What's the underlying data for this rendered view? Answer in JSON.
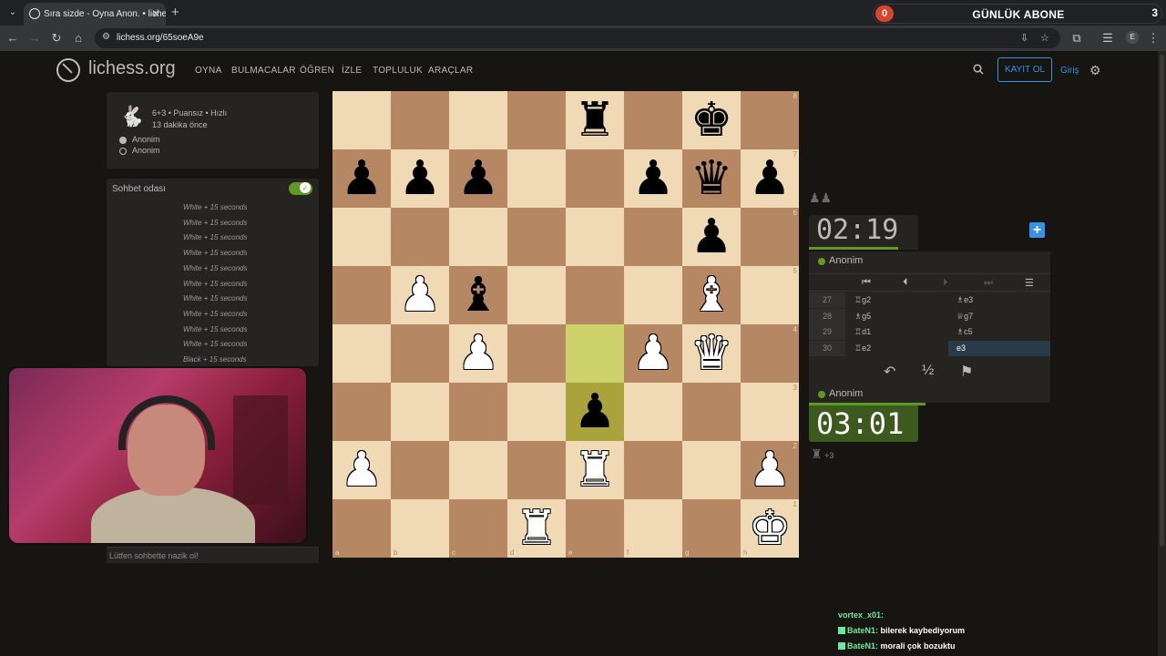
{
  "browser": {
    "tab_title": "Sıra sizde - Oyna Anon. • liches",
    "url": "lichess.org/65soeA9e",
    "profile_initial": "E"
  },
  "overlay": {
    "counter_left": "0",
    "title": "GÜNLÜK ABONE",
    "counter_right": "3"
  },
  "site": {
    "logo": "lichess.org",
    "nav": [
      "OYNA",
      "BULMACALAR",
      "ÖĞREN",
      "İZLE",
      "TOPLULUK",
      "ARAÇLAR"
    ],
    "signup": "KAYIT OL",
    "login": "Giriş"
  },
  "game_info": {
    "mode": "6+3 • Puansız • Hızlı",
    "time_ago": "13 dakika önce",
    "players": [
      "Anonim",
      "Anonim"
    ]
  },
  "chat": {
    "title": "Sohbet odası",
    "lines": [
      "White + 15 seconds",
      "White + 15 seconds",
      "White + 15 seconds",
      "White + 15 seconds",
      "White + 15 seconds",
      "White + 15 seconds",
      "White + 15 seconds",
      "White + 15 seconds",
      "White + 15 seconds",
      "White + 15 seconds",
      "Black + 15 seconds"
    ],
    "placeholder": "Lütfen sohbette nazik ol!"
  },
  "board": {
    "files": [
      "a",
      "b",
      "c",
      "d",
      "e",
      "f",
      "g",
      "h"
    ],
    "ranks": [
      "8",
      "7",
      "6",
      "5",
      "4",
      "3",
      "2",
      "1"
    ],
    "position": [
      [
        "",
        "",
        "",
        "",
        "r",
        "",
        "k",
        ""
      ],
      [
        "p",
        "p",
        "p",
        "",
        "",
        "p",
        "q",
        "p"
      ],
      [
        "",
        "",
        "",
        "",
        "",
        "",
        "p",
        ""
      ],
      [
        "",
        "P",
        "b",
        "",
        "",
        "",
        "B",
        ""
      ],
      [
        "",
        "",
        "P",
        "",
        "",
        "P",
        "Q",
        ""
      ],
      [
        "",
        "",
        "",
        "",
        "p",
        "",
        "",
        ""
      ],
      [
        "P",
        "",
        "",
        "",
        "R",
        "",
        "",
        "P"
      ],
      [
        "",
        "",
        "",
        "R",
        "",
        "",
        "",
        "K"
      ]
    ],
    "last_move": [
      "e4",
      "e3"
    ]
  },
  "opponent": {
    "name": "Anonim",
    "clock": "02:19"
  },
  "player": {
    "name": "Anonim",
    "clock": "03:01",
    "bonus": "+3"
  },
  "moves": [
    {
      "num": "27",
      "white": "♖g2",
      "black": "♗e3"
    },
    {
      "num": "28",
      "white": "♗g5",
      "black": "♕g7"
    },
    {
      "num": "29",
      "white": "♖d1",
      "black": "♗c5"
    },
    {
      "num": "30",
      "white": "♖e2",
      "black": "e3"
    }
  ],
  "actions": {
    "takeback": "↶",
    "draw": "½",
    "resign": "⚑"
  },
  "stream_chat": [
    {
      "name": "vortex_x01:",
      "text": "",
      "badge": false
    },
    {
      "name": "BateN1:",
      "text": "bilerek kaybediyorum",
      "badge": true
    },
    {
      "name": "BateN1:",
      "text": "morali çok bozuktu",
      "badge": true
    }
  ],
  "colors": {
    "accent": "#3692e7",
    "online": "#629924",
    "light_square": "#f0d9b5",
    "dark_square": "#b58863"
  }
}
